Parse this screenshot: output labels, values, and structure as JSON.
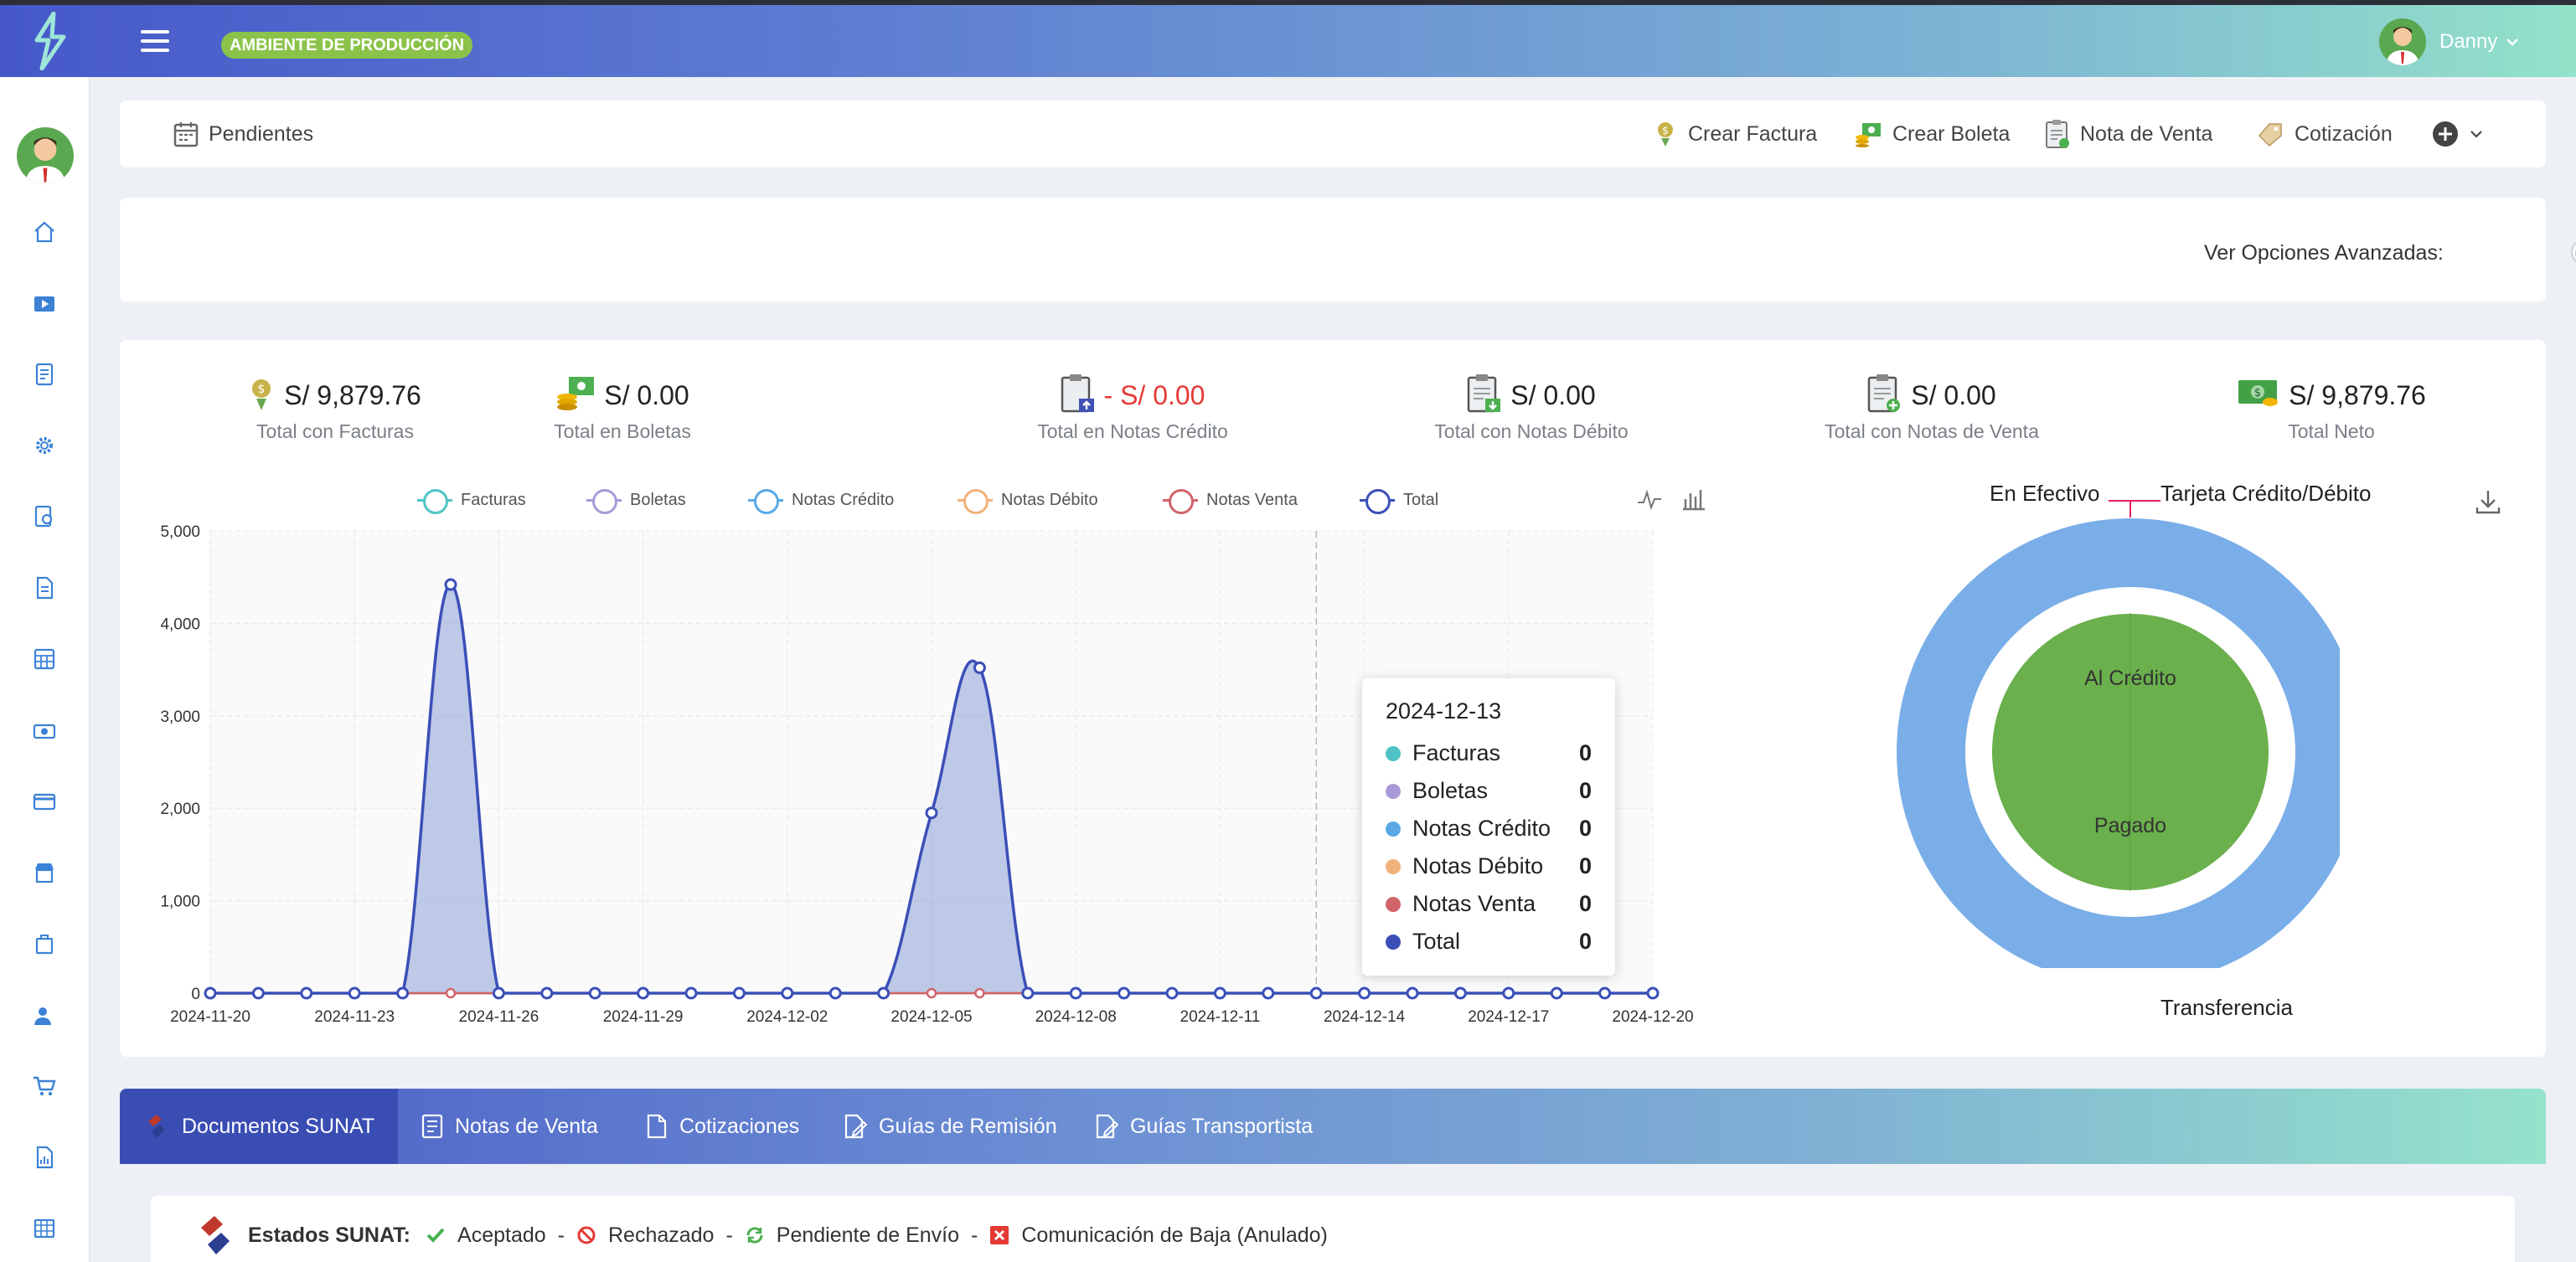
{
  "header": {
    "env_badge": "AMBIENTE DE PRODUCCIÓN",
    "user_name": "Danny"
  },
  "quickbar": {
    "pending": "Pendientes",
    "actions": [
      "Crear Factura",
      "Crear Boleta",
      "Nota de Venta",
      "Cotización"
    ]
  },
  "advanced": {
    "label": "Ver Opciones Avanzadas:",
    "enabled": false
  },
  "stats": [
    {
      "value": "S/ 9,879.76",
      "label": "Total con Facturas",
      "icon": "invoice-money-icon"
    },
    {
      "value": "S/ 0.00",
      "label": "Total en Boletas",
      "icon": "cash-coins-icon"
    },
    {
      "value": "- S/ 0.00",
      "label": "Total en Notas Crédito",
      "icon": "clipboard-up-icon",
      "negative": true
    },
    {
      "value": "S/ 0.00",
      "label": "Total con Notas Débito",
      "icon": "clipboard-down-icon"
    },
    {
      "value": "S/ 0.00",
      "label": "Total con Notas de Venta",
      "icon": "clipboard-plus-icon"
    },
    {
      "value": "S/ 9,879.76",
      "label": "Total Neto",
      "icon": "banknote-icon"
    }
  ],
  "chart_data": [
    {
      "type": "area",
      "x": [
        "2024-11-20",
        "2024-11-21",
        "2024-11-22",
        "2024-11-23",
        "2024-11-24",
        "2024-11-25",
        "2024-11-26",
        "2024-11-27",
        "2024-11-28",
        "2024-11-29",
        "2024-11-30",
        "2024-12-01",
        "2024-12-02",
        "2024-12-03",
        "2024-12-04",
        "2024-12-05",
        "2024-12-06",
        "2024-12-07",
        "2024-12-08",
        "2024-12-09",
        "2024-12-10",
        "2024-12-11",
        "2024-12-12",
        "2024-12-13",
        "2024-12-14",
        "2024-12-15",
        "2024-12-16",
        "2024-12-17",
        "2024-12-18",
        "2024-12-19",
        "2024-12-20"
      ],
      "x_ticks": [
        "2024-11-20",
        "2024-11-23",
        "2024-11-26",
        "2024-11-29",
        "2024-12-02",
        "2024-12-05",
        "2024-12-08",
        "2024-12-11",
        "2024-12-14",
        "2024-12-17",
        "2024-12-20"
      ],
      "y_ticks": [
        "0",
        "1,000",
        "2,000",
        "3,000",
        "4,000",
        "5,000"
      ],
      "ylim": [
        0,
        5000
      ],
      "grid": true,
      "legend_position": "top",
      "series": [
        {
          "name": "Facturas",
          "color": "#4fc3c3",
          "values": [
            0,
            0,
            0,
            0,
            0,
            4420,
            0,
            0,
            0,
            0,
            0,
            0,
            0,
            0,
            0,
            1950,
            3520,
            0,
            0,
            0,
            0,
            0,
            0,
            0,
            0,
            0,
            0,
            0,
            0,
            0,
            0
          ]
        },
        {
          "name": "Boletas",
          "color": "#a89ad8",
          "values": [
            0,
            0,
            0,
            0,
            0,
            0,
            0,
            0,
            0,
            0,
            0,
            0,
            0,
            0,
            0,
            0,
            0,
            0,
            0,
            0,
            0,
            0,
            0,
            0,
            0,
            0,
            0,
            0,
            0,
            0,
            0
          ]
        },
        {
          "name": "Notas Crédito",
          "color": "#5aa9e6",
          "values": [
            0,
            0,
            0,
            0,
            0,
            0,
            0,
            0,
            0,
            0,
            0,
            0,
            0,
            0,
            0,
            0,
            0,
            0,
            0,
            0,
            0,
            0,
            0,
            0,
            0,
            0,
            0,
            0,
            0,
            0,
            0
          ]
        },
        {
          "name": "Notas Débito",
          "color": "#f0b27a",
          "values": [
            0,
            0,
            0,
            0,
            0,
            0,
            0,
            0,
            0,
            0,
            0,
            0,
            0,
            0,
            0,
            0,
            0,
            0,
            0,
            0,
            0,
            0,
            0,
            0,
            0,
            0,
            0,
            0,
            0,
            0,
            0
          ]
        },
        {
          "name": "Notas Venta",
          "color": "#d0646a",
          "values": [
            0,
            0,
            0,
            0,
            0,
            0,
            0,
            0,
            0,
            0,
            0,
            0,
            0,
            0,
            0,
            0,
            0,
            0,
            0,
            0,
            0,
            0,
            0,
            0,
            0,
            0,
            0,
            0,
            0,
            0,
            0
          ]
        },
        {
          "name": "Total",
          "color": "#3b4fb8",
          "values": [
            0,
            0,
            0,
            0,
            0,
            4420,
            0,
            0,
            0,
            0,
            0,
            0,
            0,
            0,
            0,
            1950,
            3520,
            0,
            0,
            0,
            0,
            0,
            0,
            0,
            0,
            0,
            0,
            0,
            0,
            0,
            0
          ]
        }
      ],
      "tooltip": {
        "date": "2024-12-13",
        "rows": [
          {
            "name": "Facturas",
            "value": "0",
            "color": "#4fc3c3"
          },
          {
            "name": "Boletas",
            "value": "0",
            "color": "#a89ad8"
          },
          {
            "name": "Notas Crédito",
            "value": "0",
            "color": "#5aa9e6"
          },
          {
            "name": "Notas Débito",
            "value": "0",
            "color": "#f0b27a"
          },
          {
            "name": "Notas Venta",
            "value": "0",
            "color": "#d0646a"
          },
          {
            "name": "Total",
            "value": "0",
            "color": "#3b4fb8"
          }
        ]
      }
    },
    {
      "type": "pie",
      "outer": {
        "labels": [
          "En Efectivo",
          "Tarjeta Crédito/Débito",
          "Transferencia"
        ],
        "values": [
          0,
          0,
          9879.76
        ],
        "colors": [
          "#e91e63",
          "#8e44ad",
          "#7aaee8"
        ]
      },
      "inner": {
        "labels": [
          "Al Crédito",
          "Pagado"
        ],
        "values": [
          50,
          50
        ],
        "color": "#6ab04c"
      }
    }
  ],
  "tabs": [
    "Documentos SUNAT",
    "Notas de Venta",
    "Cotizaciones",
    "Guías de Remisión",
    "Guías Transportista"
  ],
  "sunat": {
    "label": "Estados SUNAT:",
    "states": [
      "Aceptado",
      "Rechazado",
      "Pendiente de Envío",
      "Comunicación de Baja (Anulado)"
    ]
  }
}
